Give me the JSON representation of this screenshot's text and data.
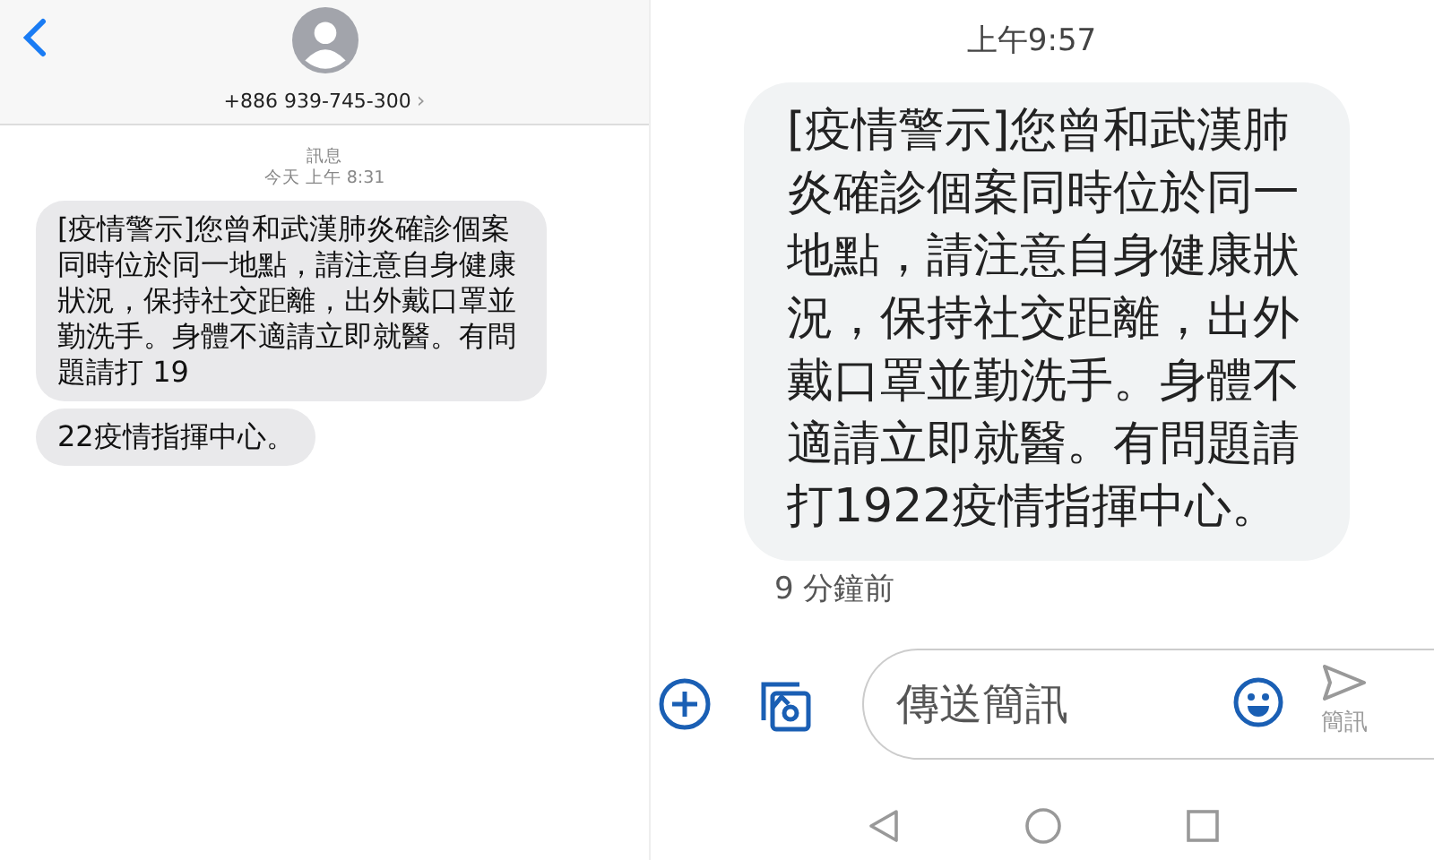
{
  "left_screen": {
    "contact": "+886 939-745-300",
    "chevron": "›",
    "service_label": "訊息",
    "timestamp": "今天 上午 8:31",
    "messages": [
      "[疫情警示]您曾和武漢肺炎確診個案同時位於同一地點，請注意自身健康狀況，保持社交距離，出外戴口罩並勤洗手。身體不適請立即就醫。有問題請打 19",
      "22疫情指揮中心。"
    ]
  },
  "right_screen": {
    "time": "上午9:57",
    "message": "[疫情警示]您曾和武漢肺炎確診個案同時位於同一地點，請注意自身健康狀況，保持社交距離，出外戴口罩並勤洗手。身體不適請立即就醫。有問題請打1922疫情指揮中心。",
    "message_age": "9 分鐘前",
    "compose": {
      "placeholder": "傳送簡訊",
      "send_label": "簡訊"
    }
  }
}
